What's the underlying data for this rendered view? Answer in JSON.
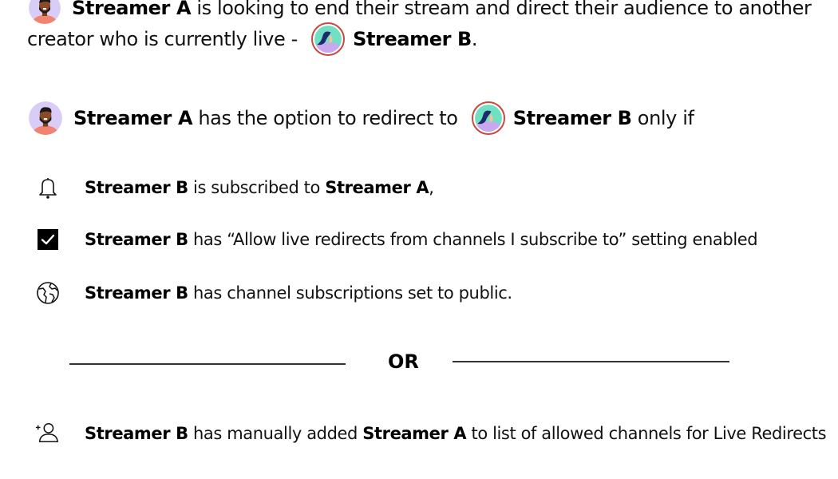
{
  "intro": {
    "line1_name": "Streamer A",
    "line1_text": " is looking to end their stream and direct their audience to another",
    "line2_text": "creator who is currently live - ",
    "line2_name": "Streamer B",
    "line2_end": "."
  },
  "condition_header": {
    "name_a": "Streamer A",
    "middle": " has the option to redirect to ",
    "name_b": "Streamer B",
    "end": " only if"
  },
  "conditions": [
    {
      "icon": "bell-icon",
      "name_b": "Streamer B",
      "text1": " is subscribed to ",
      "name_a": "Streamer A",
      "text2": ","
    },
    {
      "icon": "checkbox-checked-icon",
      "name_b": "Streamer B",
      "text1": " has “Allow live redirects from channels I subscribe to” setting enabled"
    },
    {
      "icon": "globe-icon",
      "name_b": "Streamer B",
      "text1": " has channel subscriptions set to public."
    }
  ],
  "separator": {
    "label": "OR"
  },
  "alternative": {
    "icon": "add-user-icon",
    "name_b": "Streamer B",
    "text1": " has manually added ",
    "name_a": "Streamer A",
    "text2": " to list of allowed channels for Live Redirects"
  },
  "colors": {
    "avatar_a_bg": "#d9ccf7",
    "avatar_a_shirt": "#f08470",
    "avatar_b_bg": "#6fe0c4",
    "avatar_b_shirt": "#c9a8ef",
    "avatar_b_ring": "#c9473d"
  }
}
